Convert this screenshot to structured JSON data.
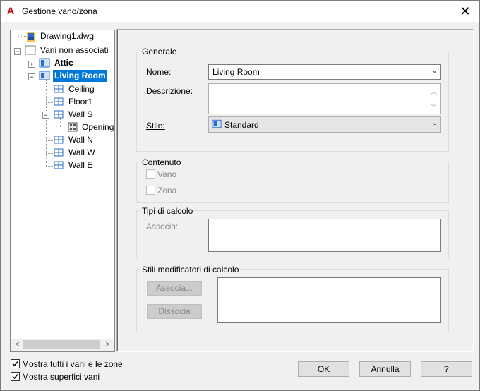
{
  "window": {
    "title": "Gestione vano/zona"
  },
  "tree": {
    "root": "Drawing1.dwg",
    "unassigned": "Vani non associati",
    "attic": "Attic",
    "living_room": "Living Room",
    "children": [
      "Ceiling",
      "Floor1",
      "Wall S",
      "Opening",
      "Wall N",
      "Wall W",
      "Wall E"
    ]
  },
  "generale": {
    "legend": "Generale",
    "nome_label": "Nome:",
    "nome_value": "Living Room",
    "descrizione_label": "Descrizione:",
    "descrizione_value": "",
    "stile_label": "Stile:",
    "stile_value": "Standard"
  },
  "contenuto": {
    "legend": "Contenuto",
    "vano": "Vano",
    "zona": "Zona"
  },
  "tipi": {
    "legend": "Tipi di calcolo",
    "associa_label": "Associa:"
  },
  "stili": {
    "legend": "Stili modificatori di calcolo",
    "associa_button": "Associa...",
    "dissocia_button": "Dissocia"
  },
  "footer": {
    "mostra_tutti": "Mostra tutti i vani e le zone",
    "mostra_superfici": "Mostra superfici vani",
    "ok": "OK",
    "annulla": "Annulla",
    "help": "?"
  }
}
